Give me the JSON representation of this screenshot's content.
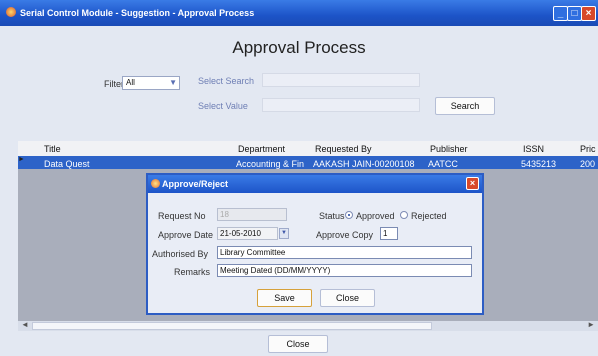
{
  "window": {
    "title": "Serial Control Module - Suggestion - Approval Process"
  },
  "page": {
    "heading": "Approval Process"
  },
  "filter": {
    "label": "Filter",
    "value": "All",
    "select_search_label": "Select Search",
    "select_value_label": "Select Value",
    "search_button": "Search"
  },
  "grid": {
    "columns": [
      "Title",
      "Department",
      "Requested By",
      "Publisher",
      "ISSN",
      "Pric"
    ],
    "rows": [
      [
        "Data Quest",
        "Accounting & Fin",
        "AAKASH JAIN-00200108",
        "AATCC",
        "5435213",
        "200"
      ]
    ]
  },
  "dialog": {
    "title": "Approve/Reject",
    "request_no_label": "Request No",
    "request_no_value": "18",
    "status_label": "Status",
    "approved_label": "Approved",
    "rejected_label": "Rejected",
    "approve_date_label": "Approve Date",
    "approve_date_value": "21-05-2010",
    "approve_copy_label": "Approve Copy",
    "approve_copy_value": "1",
    "authorised_by_label": "Authorised By",
    "authorised_by_value": "Library Committee",
    "remarks_label": "Remarks",
    "remarks_value": "Meeting Dated (DD/MM/YYYY)",
    "save_button": "Save",
    "close_button": "Close"
  },
  "footer": {
    "close_button": "Close"
  }
}
